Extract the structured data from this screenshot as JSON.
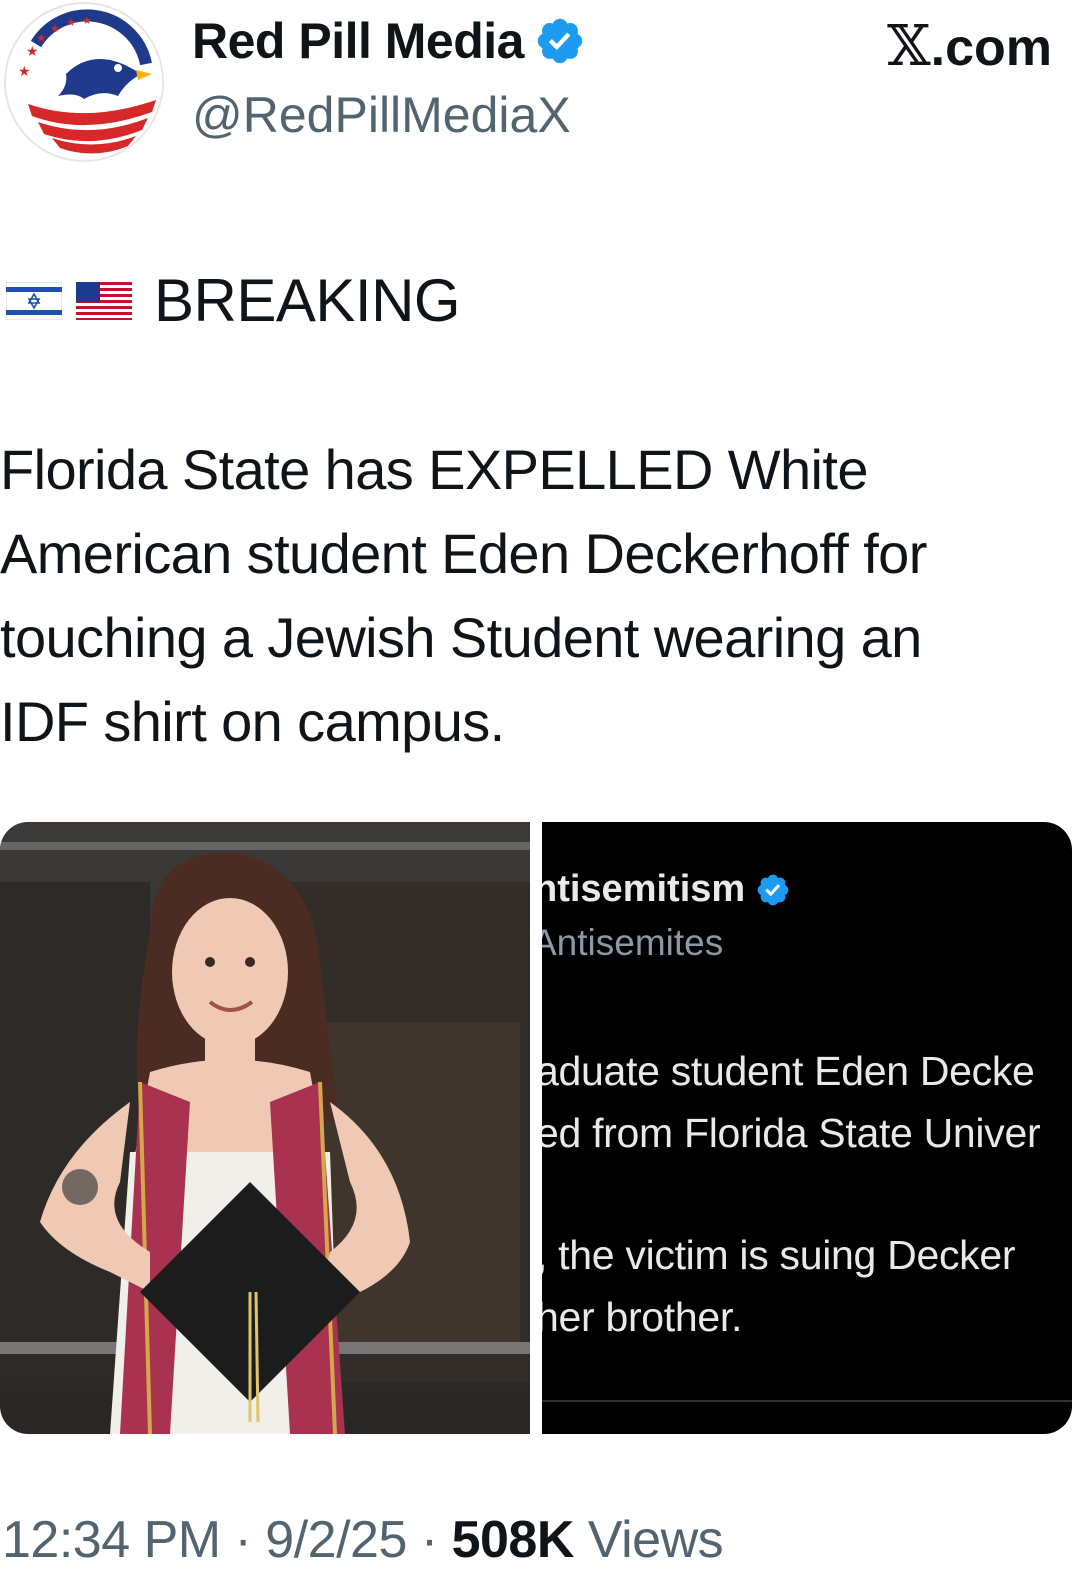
{
  "header": {
    "display_name": "Red Pill Media",
    "handle": "@RedPillMediaX",
    "site_x": "𝕏",
    "site_suffix": ".com",
    "verified_icon": "verified-badge-icon",
    "avatar_icon": "eagle-flag-logo"
  },
  "post": {
    "flags": [
      "israel-flag-icon",
      "us-flag-icon"
    ],
    "breaking": "BREAKING",
    "lines": [
      "Florida State has EXPELLED White",
      "American student Eden Deckerhoff for",
      "touching a Jewish Student wearing an",
      "IDF shirt on campus."
    ]
  },
  "media": {
    "photo_description_icon": "graduate-photo",
    "screenshot": {
      "name": "ntisemitism",
      "handle": "Antisemites",
      "line1": "aduate student Eden Decke",
      "line2": "ed from Florida State Univer",
      "line3": ", the victim is suing Decker",
      "line4": "her brother."
    }
  },
  "footer": {
    "time": "12:34 PM",
    "sep1": " · ",
    "date": "9/2/25",
    "sep2": " · ",
    "views_count": "508K",
    "views_label": " Views"
  },
  "colors": {
    "verified_blue": "#1d9bf0",
    "muted": "#536471",
    "text": "#0f1419"
  }
}
